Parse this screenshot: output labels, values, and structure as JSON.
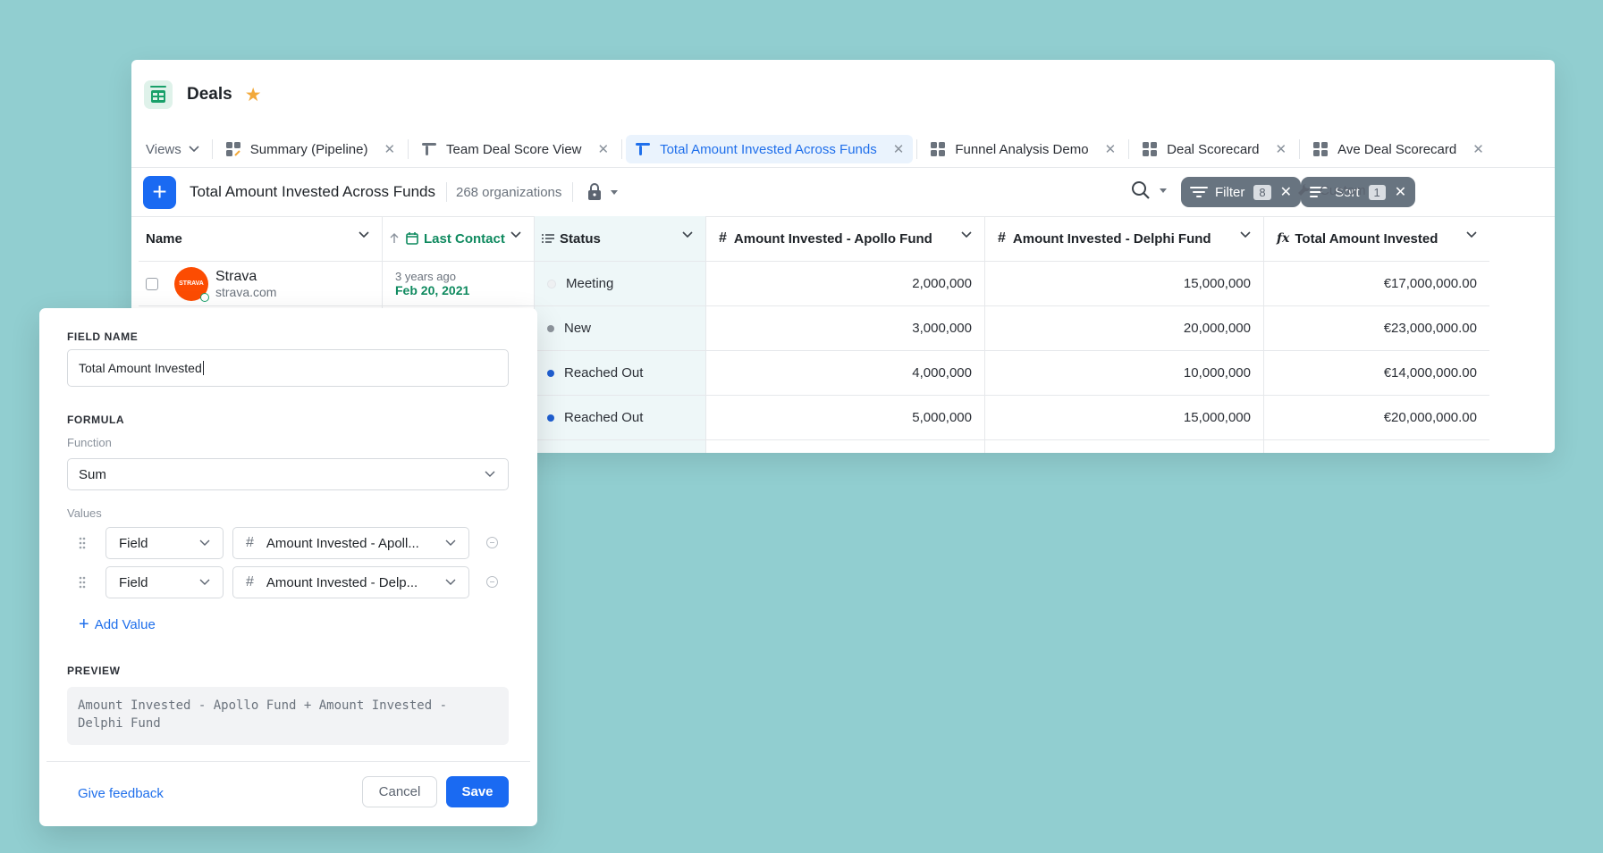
{
  "app": {
    "title": "Deals"
  },
  "tabs": {
    "views_label": "Views",
    "items": [
      {
        "label": "Summary (Pipeline)",
        "icon": "board-icon",
        "active": false
      },
      {
        "label": "Team Deal Score View",
        "icon": "pin-icon",
        "active": false
      },
      {
        "label": "Total Amount Invested Across Funds",
        "icon": "pin-icon",
        "active": true
      },
      {
        "label": "Funnel Analysis Demo",
        "icon": "board-icon",
        "active": false
      },
      {
        "label": "Deal Scorecard",
        "icon": "board-icon",
        "active": false
      },
      {
        "label": "Ave Deal Scorecard",
        "icon": "board-icon",
        "active": false
      }
    ]
  },
  "toolbar": {
    "add_label": "+",
    "view_name": "Total Amount Invested Across Funds",
    "count": "268 organizations",
    "filter_label": "Filter",
    "filter_count": "8",
    "sort_label": "Sort",
    "sort_count": "1",
    "customize_label": "Custom"
  },
  "table": {
    "columns": [
      {
        "label": "Name"
      },
      {
        "label": "Last Contact"
      },
      {
        "label": "Status"
      },
      {
        "label": "Amount Invested - Apollo Fund"
      },
      {
        "label": "Amount Invested - Delphi Fund"
      },
      {
        "label": "Total Amount Invested"
      }
    ],
    "rows": [
      {
        "name": "Strava",
        "domain": "strava.com",
        "logo_text": "STRAVA",
        "last_contact_rel": "3 years ago",
        "last_contact_date": "Feb 20, 2021",
        "status": "Meeting",
        "status_color": "#e9ecef",
        "apollo": "2,000,000",
        "delphi": "15,000,000",
        "total": "€17,000,000.00"
      },
      {
        "status": "New",
        "status_color": "#8d949c",
        "apollo": "3,000,000",
        "delphi": "20,000,000",
        "total": "€23,000,000.00"
      },
      {
        "status": "Reached Out",
        "status_color": "#1f5fd1",
        "apollo": "4,000,000",
        "delphi": "10,000,000",
        "total": "€14,000,000.00"
      },
      {
        "status": "Reached Out",
        "status_color": "#1f5fd1",
        "apollo": "5,000,000",
        "delphi": "15,000,000",
        "total": "€20,000,000.00"
      }
    ]
  },
  "panel": {
    "field_name_label": "FIELD NAME",
    "field_name_value": "Total Amount Invested",
    "formula_label": "FORMULA",
    "function_label": "Function",
    "function_value": "Sum",
    "values_label": "Values",
    "values": [
      {
        "type": "Field",
        "field": "Amount Invested - Apoll..."
      },
      {
        "type": "Field",
        "field": "Amount Invested - Delp..."
      }
    ],
    "add_value_label": "Add Value",
    "preview_label": "PREVIEW",
    "preview_line1": "Amount Invested - Apollo Fund + Amount Invested -",
    "preview_line2": "Delphi Fund",
    "feedback_label": "Give feedback",
    "cancel_label": "Cancel",
    "save_label": "Save"
  },
  "colors": {
    "accent": "#1a6af2",
    "background": "#91ced0",
    "status_column": "#eef7f8",
    "link": "#1f6feb",
    "date_green": "#0f8a5f",
    "strava_orange": "#fc4c02"
  }
}
